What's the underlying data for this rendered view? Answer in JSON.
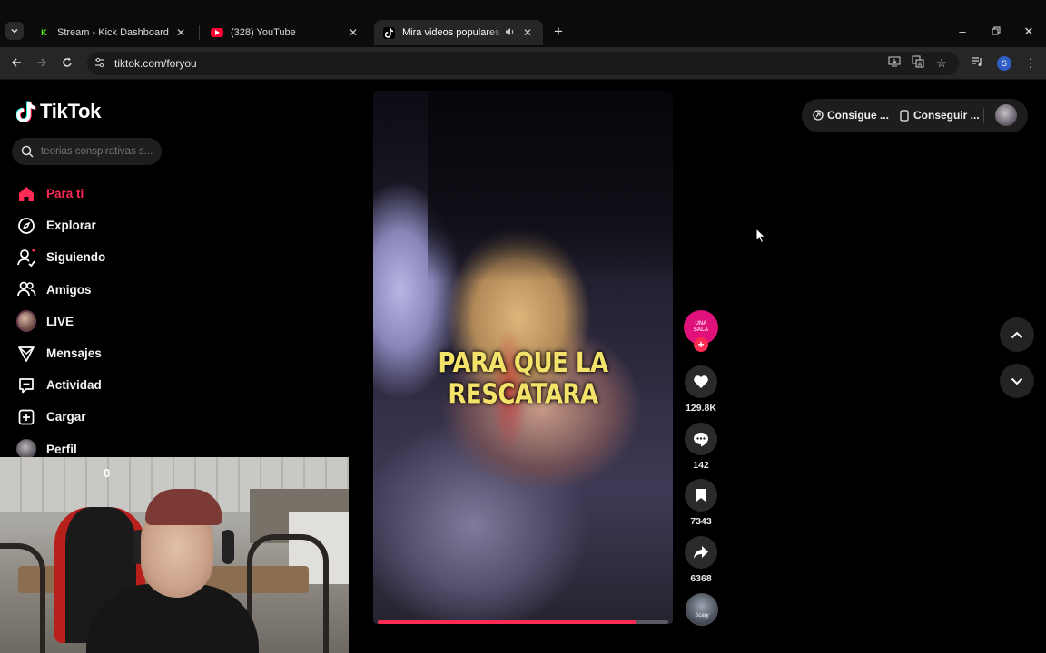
{
  "browser": {
    "tabs": [
      {
        "title": "Stream - Kick Dashboard",
        "favicon": "kick-icon",
        "active": false
      },
      {
        "title": "(328) YouTube",
        "favicon": "youtube-icon",
        "active": false
      },
      {
        "title": "Mira videos populares selec",
        "favicon": "tiktok-icon",
        "active": true
      }
    ],
    "url": "tiktok.com/foryou",
    "profile_initial": "S"
  },
  "sidebar": {
    "logo": "TikTok",
    "search_placeholder": "teorias conspirativas s...",
    "items": [
      {
        "label": "Para ti",
        "icon": "home-icon",
        "active": true
      },
      {
        "label": "Explorar",
        "icon": "compass-icon",
        "active": false
      },
      {
        "label": "Siguiendo",
        "icon": "following-icon",
        "active": false
      },
      {
        "label": "Amigos",
        "icon": "friends-icon",
        "active": false
      },
      {
        "label": "LIVE",
        "icon": "live-avatar-icon",
        "active": false
      },
      {
        "label": "Mensajes",
        "icon": "send-icon",
        "active": false
      },
      {
        "label": "Actividad",
        "icon": "activity-icon",
        "active": false
      },
      {
        "label": "Cargar",
        "icon": "upload-icon",
        "active": false
      },
      {
        "label": "Perfil",
        "icon": "profile-avatar-icon",
        "active": false
      }
    ]
  },
  "webcam": {
    "counter": "0"
  },
  "video": {
    "subtitle": "PARA QUE LA RESCATARA",
    "progress": 0.89
  },
  "actions": {
    "creator_avatar_text": "UNA SALA",
    "likes": "129.8K",
    "comments": "142",
    "saves": "7343",
    "shares": "6368",
    "music_label": "Scary"
  },
  "top_right": {
    "coins_label": "Consigue ...",
    "app_label": "Conseguir ..."
  },
  "colors": {
    "accent": "#fe2c55",
    "background": "#000000",
    "subtitle": "#f4e36a"
  }
}
